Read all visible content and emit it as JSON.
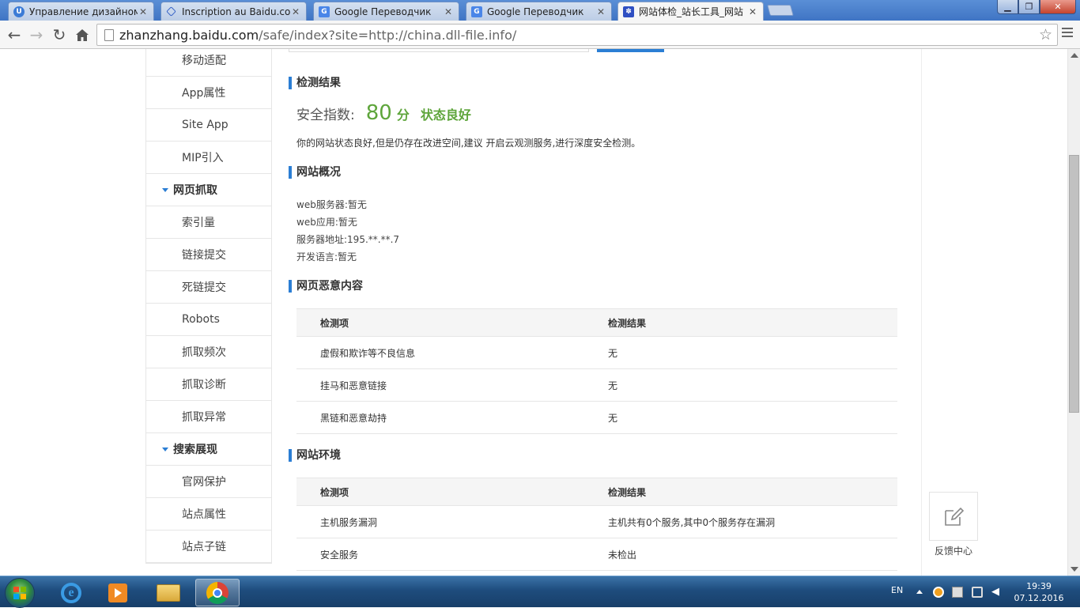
{
  "browser": {
    "tabs": [
      {
        "title": "Управление дизайном - ",
        "icon": "U",
        "active": false
      },
      {
        "title": "Inscription au Baidu.com,",
        "icon": "baidu-diamond",
        "active": false
      },
      {
        "title": "Google Переводчик",
        "icon": "G",
        "active": false
      },
      {
        "title": "Google Переводчик",
        "icon": "G",
        "active": false
      },
      {
        "title": "网站体检_站长工具_网站",
        "icon": "baidu-paw",
        "active": true
      }
    ],
    "url_host": "zhanzhang.baidu.com",
    "url_path": "/safe/index?site=http://china.dll-file.info/"
  },
  "sidebar": {
    "items": [
      {
        "label": "移动适配",
        "type": "item"
      },
      {
        "label": "App属性",
        "type": "item"
      },
      {
        "label": "Site App",
        "type": "item"
      },
      {
        "label": "MIP引入",
        "type": "item"
      },
      {
        "label": "网页抓取",
        "type": "group"
      },
      {
        "label": "索引量",
        "type": "item"
      },
      {
        "label": "链接提交",
        "type": "item"
      },
      {
        "label": "死链提交",
        "type": "item"
      },
      {
        "label": "Robots",
        "type": "item"
      },
      {
        "label": "抓取频次",
        "type": "item"
      },
      {
        "label": "抓取诊断",
        "type": "item"
      },
      {
        "label": "抓取异常",
        "type": "item"
      },
      {
        "label": "搜索展现",
        "type": "group"
      },
      {
        "label": "官网保护",
        "type": "item"
      },
      {
        "label": "站点属性",
        "type": "item"
      },
      {
        "label": "站点子链",
        "type": "item"
      }
    ]
  },
  "result": {
    "section_title": "检测结果",
    "score_label": "安全指数:",
    "score_value": "80",
    "score_unit": "分",
    "status": "状态良好",
    "description": "你的网站状态良好,但是仍存在改进空间,建议 开启云观测服务,进行深度安全检测。"
  },
  "overview": {
    "section_title": "网站概况",
    "lines": [
      "web服务器:暂无",
      "web应用:暂无",
      "服务器地址:195.**.**.7",
      "开发语言:暂无"
    ]
  },
  "malicious": {
    "section_title": "网页恶意内容",
    "headers": [
      "检测项",
      "检测结果"
    ],
    "rows": [
      [
        "虚假和欺诈等不良信息",
        "无"
      ],
      [
        "挂马和恶意链接",
        "无"
      ],
      [
        "黑链和恶意劫持",
        "无"
      ]
    ]
  },
  "environment": {
    "section_title": "网站环境",
    "headers": [
      "检测项",
      "检测结果"
    ],
    "rows": [
      [
        "主机服务漏洞",
        "主机共有0个服务,其中0个服务存在漏洞"
      ],
      [
        "安全服务",
        "未检出"
      ]
    ]
  },
  "feedback": {
    "label": "反馈中心"
  },
  "taskbar": {
    "lang": "EN",
    "time": "19:39",
    "date": "07.12.2016"
  },
  "colors": {
    "accent": "#2b7ed4",
    "score_green": "#5ea53b"
  }
}
